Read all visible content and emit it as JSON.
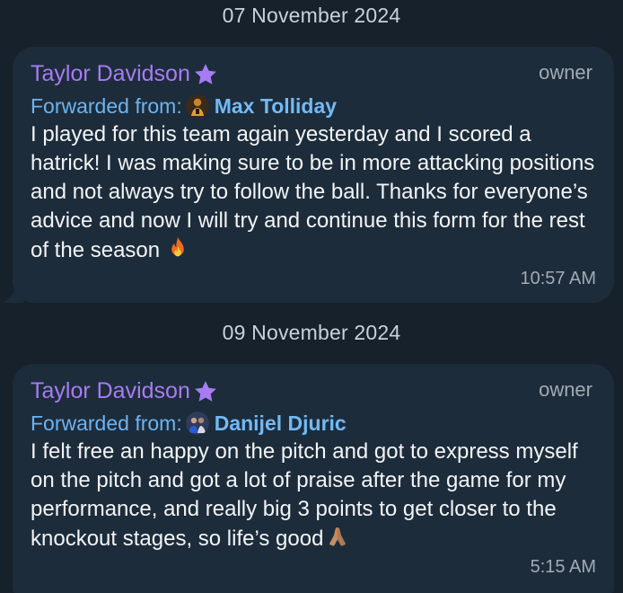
{
  "messages": [
    {
      "date": "07 November 2024",
      "sender": "Taylor Davidson",
      "role": "owner",
      "forwarded_label": "Forwarded from:",
      "forwarded_name": "Max Tolliday",
      "text": "I played for this team again yesterday and I scored a hatrick! I was making sure to be in more attacking positions and not always try to follow the ball. Thanks for everyone’s advice and now I will try and continue this form for the rest of the season",
      "emoji": "fire-emoji",
      "time": "10:57 AM"
    },
    {
      "date": "09 November 2024",
      "sender": "Taylor Davidson",
      "role": "owner",
      "forwarded_label": "Forwarded from:",
      "forwarded_name": "Danijel Djuric",
      "text": "I felt free an happy on the pitch and got to express myself on the pitch and got a lot of praise after the game for my performance, and really big 3 points to get closer to the knockout stages, so life’s good",
      "emoji": "folded-hands-emoji",
      "time": "5:15 AM"
    }
  ],
  "colors": {
    "background": "#17212b",
    "bubble": "#1d2c3b",
    "sender": "#a77cf3",
    "forwarded": "#6cb4f0",
    "meta": "#a3aab3"
  }
}
